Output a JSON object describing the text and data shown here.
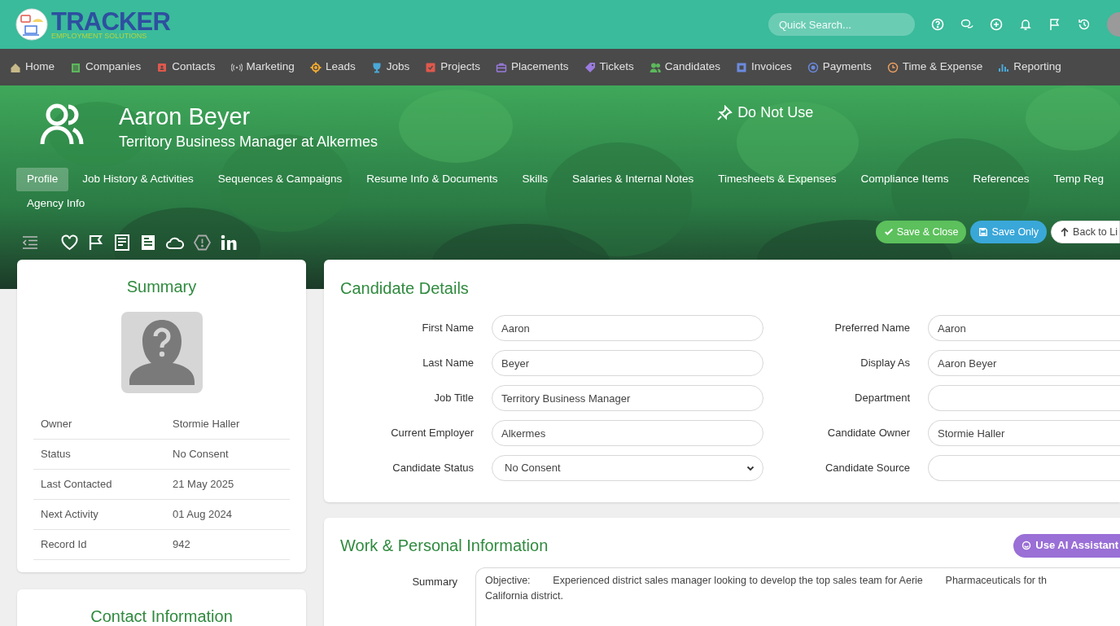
{
  "app": {
    "logo_title": "TRACKER",
    "logo_subtitle": "EMPLOYMENT SOLUTIONS",
    "search": {
      "placeholder": "Quick Search..."
    }
  },
  "nav": [
    {
      "label": "Home",
      "color": "#c8b98a"
    },
    {
      "label": "Companies",
      "color": "#5cb85c"
    },
    {
      "label": "Contacts",
      "color": "#e0584c"
    },
    {
      "label": "Marketing",
      "color": "#bdbdbd"
    },
    {
      "label": "Leads",
      "color": "#f0a830"
    },
    {
      "label": "Jobs",
      "color": "#4aa8d8"
    },
    {
      "label": "Projects",
      "color": "#e0584c"
    },
    {
      "label": "Placements",
      "color": "#9b7be0"
    },
    {
      "label": "Tickets",
      "color": "#9b7be0"
    },
    {
      "label": "Candidates",
      "color": "#5cb85c"
    },
    {
      "label": "Invoices",
      "color": "#6b8be0"
    },
    {
      "label": "Payments",
      "color": "#6b8be0"
    },
    {
      "label": "Time & Expense",
      "color": "#f0a060"
    },
    {
      "label": "Reporting",
      "color": "#4aa8d8"
    }
  ],
  "profile": {
    "name": "Aaron Beyer",
    "headline": "Territory Business Manager at Alkermes",
    "flag": "Do Not Use"
  },
  "tabs": [
    {
      "label": "Profile",
      "selected": true
    },
    {
      "label": "Job History & Activities",
      "selected": false
    },
    {
      "label": "Sequences & Campaigns",
      "selected": false
    },
    {
      "label": "Resume Info & Documents",
      "selected": false
    },
    {
      "label": "Skills",
      "selected": false
    },
    {
      "label": "Salaries & Internal Notes",
      "selected": false
    },
    {
      "label": "Timesheets & Expenses",
      "selected": false
    },
    {
      "label": "Compliance Items",
      "selected": false
    },
    {
      "label": "References",
      "selected": false
    },
    {
      "label": "Temp Reg",
      "selected": false
    },
    {
      "label": "Agency Info",
      "selected": false
    }
  ],
  "actions": [
    {
      "label": "Save & Close",
      "kind": "save_close"
    },
    {
      "label": "Save Only",
      "kind": "save"
    },
    {
      "label": "Back to Li",
      "kind": "back"
    }
  ],
  "summary": {
    "title": "Summary",
    "rows": [
      {
        "label": "Owner",
        "value": "Stormie Haller"
      },
      {
        "label": "Status",
        "value": "No Consent"
      },
      {
        "label": "Last Contacted",
        "value": "21 May 2025"
      },
      {
        "label": "Next Activity",
        "value": "01 Aug 2024"
      },
      {
        "label": "Record Id",
        "value": "942"
      }
    ]
  },
  "candidate_details": {
    "title": "Candidate Details",
    "left_fields": [
      {
        "label": "First Name",
        "value": "Aaron",
        "kind": "text"
      },
      {
        "label": "Last Name",
        "value": "Beyer",
        "kind": "text"
      },
      {
        "label": "Job Title",
        "value": "Territory Business Manager",
        "kind": "text"
      },
      {
        "label": "Current Employer",
        "value": "Alkermes",
        "kind": "text"
      },
      {
        "label": "Candidate Status",
        "value": "No Consent",
        "kind": "select"
      }
    ],
    "right_fields": [
      {
        "label": "Preferred Name",
        "value": "Aaron",
        "kind": "text"
      },
      {
        "label": "Display As",
        "value": "Aaron Beyer",
        "kind": "text"
      },
      {
        "label": "Department",
        "kind": "text"
      },
      {
        "label": "Candidate Owner",
        "value": "Stormie Haller",
        "kind": "text"
      },
      {
        "label": "Candidate Source",
        "kind": "text"
      }
    ]
  },
  "work_info": {
    "title": "Work & Personal Information",
    "ai_button": "Use AI Assistant",
    "summary_label": "Summary",
    "summary_lines": [
      "Objective:        Experienced district sales manager looking to develop the top sales team for Aerie        Pharmaceuticals for th",
      "California district."
    ]
  },
  "contact": {
    "title": "Contact Information"
  }
}
